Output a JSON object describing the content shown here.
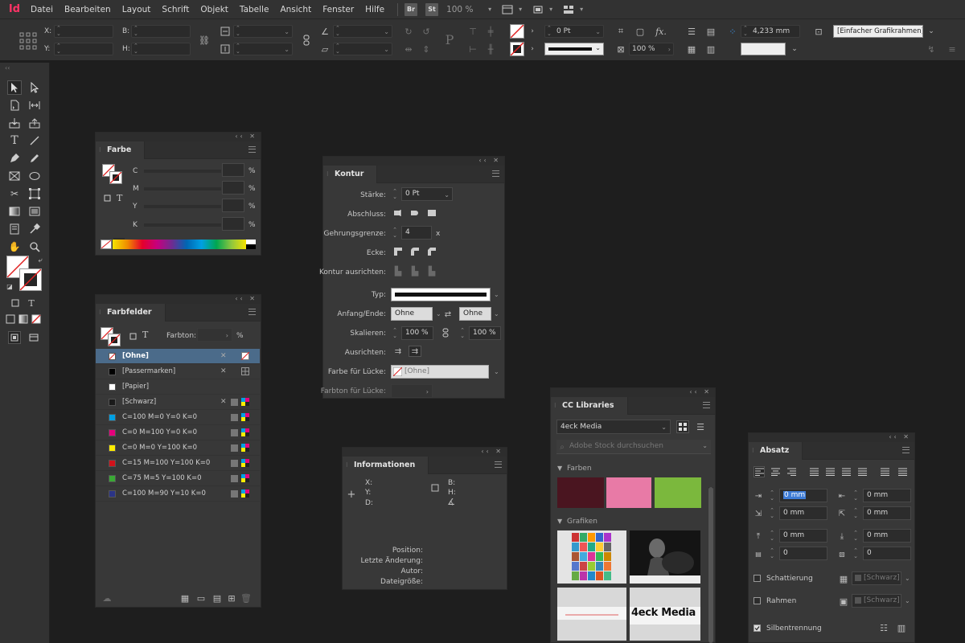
{
  "app": {
    "logo": "Id"
  },
  "menu": [
    "Datei",
    "Bearbeiten",
    "Layout",
    "Schrift",
    "Objekt",
    "Tabelle",
    "Ansicht",
    "Fenster",
    "Hilfe"
  ],
  "menubar": {
    "badge1": "Br",
    "badge2": "St",
    "zoom": "100 %"
  },
  "control": {
    "x_label": "X:",
    "y_label": "Y:",
    "w_label": "B:",
    "h_label": "H:",
    "stroke_weight": "0 Pt",
    "scale": "100 %",
    "offset": "4,233 mm",
    "object_style": "[Einfacher Grafikrahmen]+"
  },
  "farbe": {
    "title": "Farbe",
    "channels": [
      "C",
      "M",
      "Y",
      "K"
    ],
    "unit": "%",
    "t_label": "T"
  },
  "farbfelder": {
    "title": "Farbfelder",
    "tint_label": "Farbton:",
    "tint_unit": "%",
    "t_label": "T",
    "swatches": [
      {
        "name": "[Ohne]",
        "color": "none"
      },
      {
        "name": "[Passermarken]",
        "color": "#000000"
      },
      {
        "name": "[Papier]",
        "color": "#ffffff"
      },
      {
        "name": "[Schwarz]",
        "color": "#1a1a1a"
      },
      {
        "name": "C=100 M=0 Y=0 K=0",
        "color": "#00a0e3"
      },
      {
        "name": "C=0 M=100 Y=0 K=0",
        "color": "#e4007c"
      },
      {
        "name": "C=0 M=0 Y=100 K=0",
        "color": "#ffed00"
      },
      {
        "name": "C=15 M=100 Y=100 K=0",
        "color": "#d1121b"
      },
      {
        "name": "C=75 M=5 Y=100 K=0",
        "color": "#3aa935"
      },
      {
        "name": "C=100 M=90 Y=10 K=0",
        "color": "#2b3486"
      }
    ]
  },
  "kontur": {
    "title": "Kontur",
    "staerke_label": "Stärke:",
    "staerke_value": "0 Pt",
    "abschluss_label": "Abschluss:",
    "gehrung_label": "Gehrungsgrenze:",
    "gehrung_value": "4",
    "gehrung_unit": "x",
    "ecke_label": "Ecke:",
    "ausrichten_label": "Kontur ausrichten:",
    "typ_label": "Typ:",
    "anfang_label": "Anfang/Ende:",
    "anfang_value": "Ohne",
    "ende_value": "Ohne",
    "skalieren_label": "Skalieren:",
    "skal1": "100 %",
    "skal2": "100 %",
    "ausrichten2_label": "Ausrichten:",
    "farbe_luecke_label": "Farbe für Lücke:",
    "farbe_luecke_value": "[Ohne]",
    "farbton_luecke_label": "Farbton für Lücke:"
  },
  "info": {
    "title": "Informationen",
    "x": "X:",
    "y": "Y:",
    "d": "D:",
    "b": "B:",
    "h": "H:",
    "position": "Position:",
    "letzte": "Letzte Änderung:",
    "autor": "Autor:",
    "dateigroesse": "Dateigröße:"
  },
  "cc": {
    "title": "CC Libraries",
    "library": "4eck Media",
    "search_placeholder": "Adobe Stock durchsuchen",
    "farben": "Farben",
    "grafiken": "Grafiken",
    "colors": [
      "#4a1520",
      "#e87aa6",
      "#7bb83d"
    ],
    "logo_text": "4eck Media"
  },
  "absatz": {
    "title": "Absatz",
    "v1": "0 mm",
    "v2": "0 mm",
    "v3": "0 mm",
    "v4": "0 mm",
    "v5": "0 mm",
    "v6": "0 mm",
    "v7": "0",
    "v8": "0",
    "schattierung": "Schattierung",
    "rahmen": "Rahmen",
    "swatch1": "[Schwarz]",
    "swatch2": "[Schwarz]",
    "silben": "Silbentrennung"
  }
}
